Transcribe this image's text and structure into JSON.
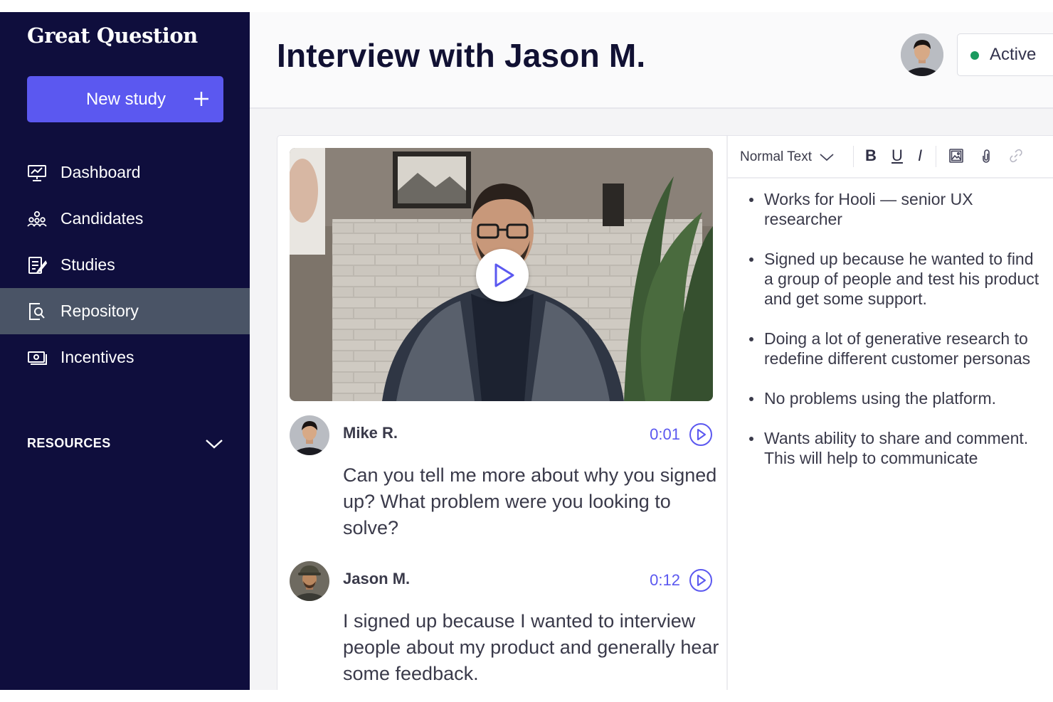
{
  "app": {
    "logo": "Great Question"
  },
  "sidebar": {
    "new_study_label": "New study",
    "items": [
      {
        "label": "Dashboard",
        "icon": "dashboard-icon"
      },
      {
        "label": "Candidates",
        "icon": "candidates-icon"
      },
      {
        "label": "Studies",
        "icon": "studies-icon"
      },
      {
        "label": "Repository",
        "icon": "repository-icon",
        "active": true
      },
      {
        "label": "Incentives",
        "icon": "incentives-icon"
      }
    ],
    "resources_label": "RESOURCES"
  },
  "header": {
    "title": "Interview with Jason M.",
    "status": "Active",
    "status_color": "#1a9a5e"
  },
  "transcript": [
    {
      "speaker": "Mike R.",
      "time": "0:01",
      "text": "Can you tell me more about why you signed up? What problem were you looking to solve?"
    },
    {
      "speaker": "Jason M.",
      "time": "0:12",
      "text": "I signed up because I wanted to interview people about my product and generally hear some feedback."
    }
  ],
  "editor": {
    "text_style": "Normal Text",
    "bold": "B",
    "underline": "U",
    "italic": "I",
    "notes": [
      "Works for Hooli — senior UX researcher",
      "Signed up because he wanted to find a group of people and test his product and get some support.",
      "Doing a lot of generative research to redefine different customer personas",
      "No problems using the platform.",
      "Wants ability to share and comment. This will help to communicate"
    ]
  },
  "colors": {
    "sidebar_bg": "#0f0e3d",
    "accent": "#5b58f0",
    "active_nav": "#4a5466"
  }
}
